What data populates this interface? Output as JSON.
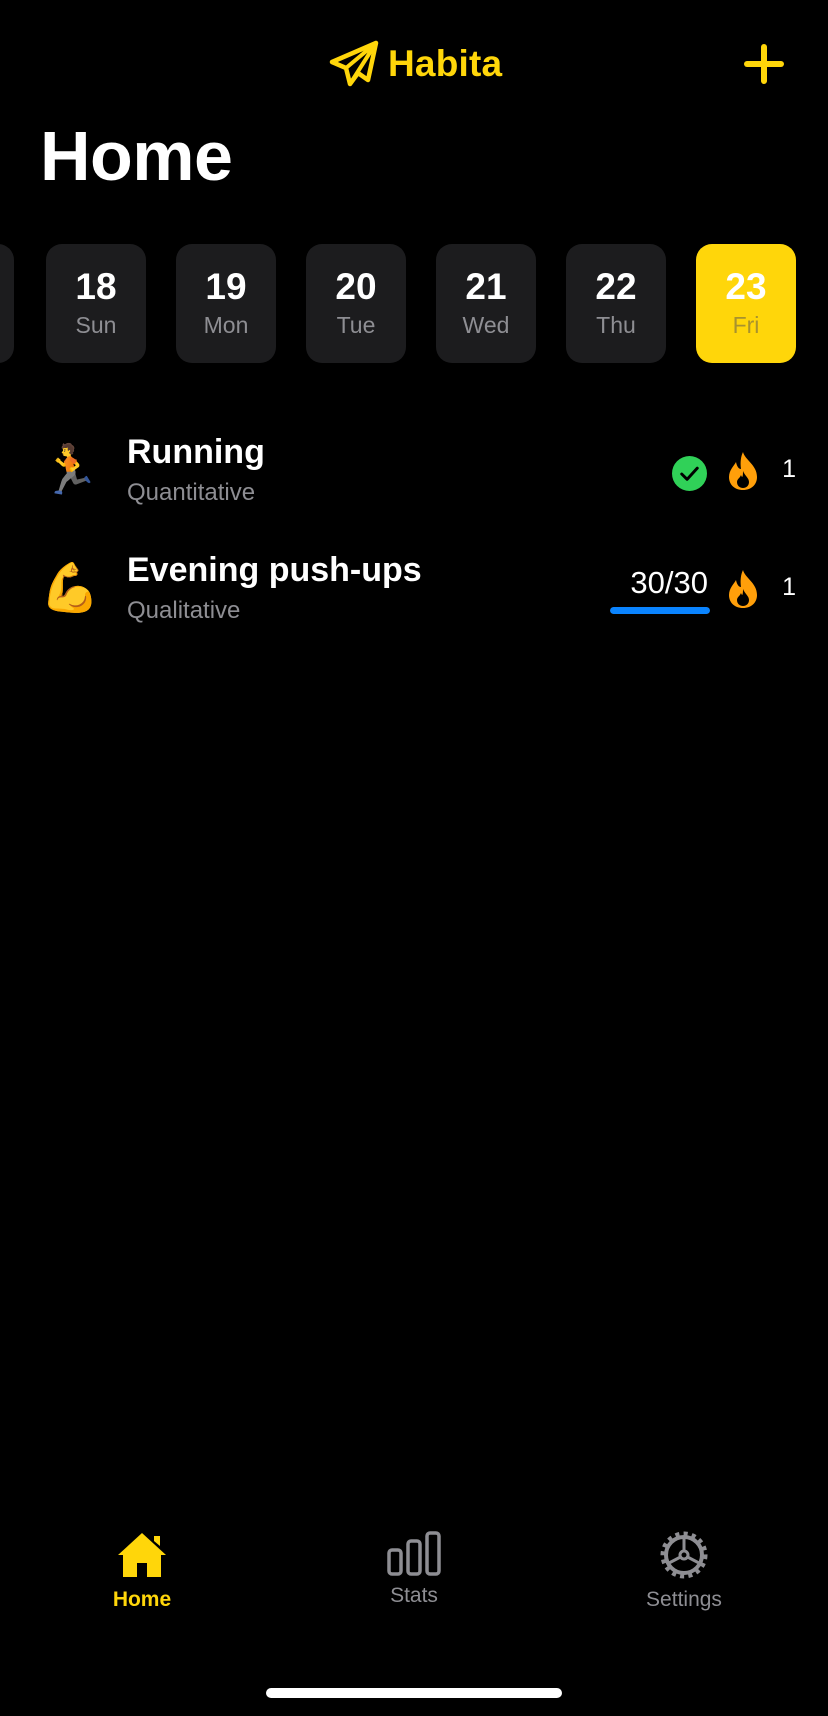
{
  "header": {
    "app_name": "Habita",
    "brand_icon": "paper-plane-icon",
    "add_icon": "plus-icon",
    "title": "Home"
  },
  "colors": {
    "accent": "#FFD60A",
    "background": "#000000",
    "cell_background": "#1C1C1E",
    "secondary_text": "#8E8E93",
    "success": "#30D158",
    "streak": "#FF9F0A",
    "progress": "#0A84FF"
  },
  "dates": [
    {
      "day": "",
      "weekday": ""
    },
    {
      "day": "18",
      "weekday": "Sun"
    },
    {
      "day": "19",
      "weekday": "Mon"
    },
    {
      "day": "20",
      "weekday": "Tue"
    },
    {
      "day": "21",
      "weekday": "Wed"
    },
    {
      "day": "22",
      "weekday": "Thu"
    },
    {
      "day": "23",
      "weekday": "Fri",
      "selected": true
    }
  ],
  "habits": [
    {
      "emoji": "🏃",
      "name": "Running",
      "type": "Quantitative",
      "status_icon": "checkmark-circle-icon",
      "completed": true,
      "streak": "1"
    },
    {
      "emoji": "💪",
      "name": "Evening push-ups",
      "type": "Qualitative",
      "progress_label": "30/30",
      "progress_fraction": 1.0,
      "streak": "1"
    }
  ],
  "tabs": [
    {
      "label": "Home",
      "icon": "house-icon",
      "active": true
    },
    {
      "label": "Stats",
      "icon": "bar-chart-icon",
      "active": false
    },
    {
      "label": "Settings",
      "icon": "gear-icon",
      "active": false
    }
  ]
}
